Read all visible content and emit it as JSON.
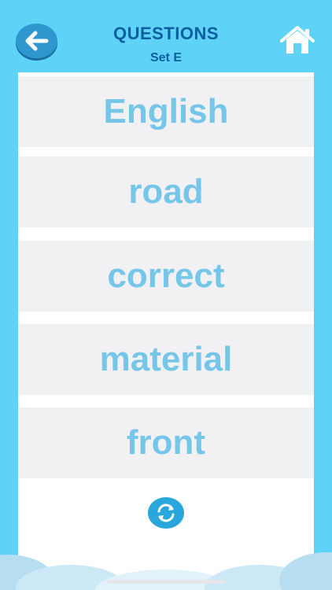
{
  "header": {
    "title": "QUESTIONS",
    "subtitle": "Set E"
  },
  "words": [
    "English",
    "road",
    "correct",
    "material",
    "front"
  ],
  "icons": {
    "back": "arrow-left-icon",
    "home": "home-icon",
    "refresh": "refresh-icon"
  },
  "colors": {
    "background": "#5fd2f7",
    "title": "#0a5f9e",
    "word_text": "#76c6ea",
    "card": "#f1f1f3",
    "accent": "#2aa7da"
  }
}
